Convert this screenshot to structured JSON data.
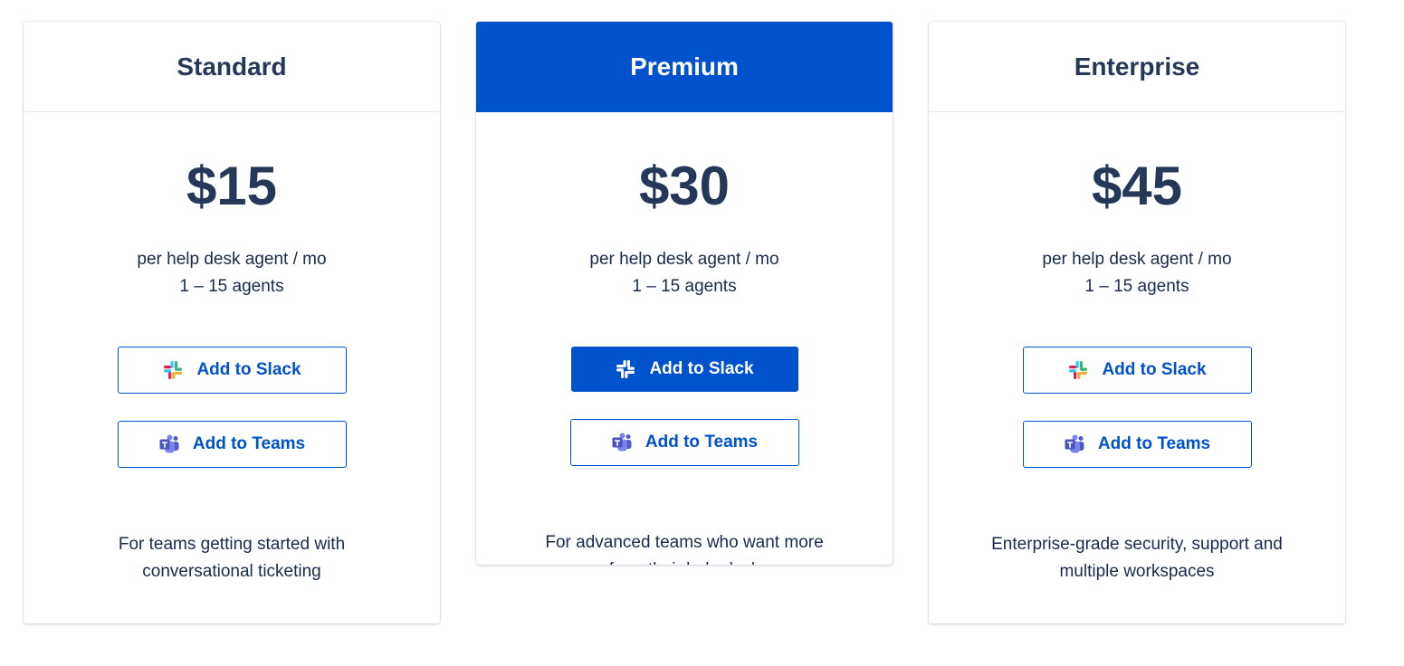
{
  "plans": [
    {
      "name": "Standard",
      "price": "$15",
      "price_unit": "per help desk agent / mo",
      "agents": "1 – 15 agents",
      "slack_button": "Add to Slack",
      "teams_button": "Add to Teams",
      "tagline_line1": "For teams getting started with",
      "tagline_line2": "conversational ticketing"
    },
    {
      "name": "Premium",
      "price": "$30",
      "price_unit": "per help desk agent / mo",
      "agents": "1 – 15 agents",
      "slack_button": "Add to Slack",
      "teams_button": "Add to Teams",
      "tagline_line1": "For advanced teams who want more",
      "tagline_line2": "from their help desk"
    },
    {
      "name": "Enterprise",
      "price": "$45",
      "price_unit": "per help desk agent / mo",
      "agents": "1 – 15 agents",
      "slack_button": "Add to Slack",
      "teams_button": "Add to Teams",
      "tagline_line1": "Enterprise-grade security, support and",
      "tagline_line2": "multiple workspaces"
    }
  ],
  "colors": {
    "brand_blue": "#0052cc",
    "heading": "#253858",
    "text": "#172b4d"
  },
  "icons": {
    "slack": "slack-icon",
    "teams": "microsoft-teams-icon"
  }
}
